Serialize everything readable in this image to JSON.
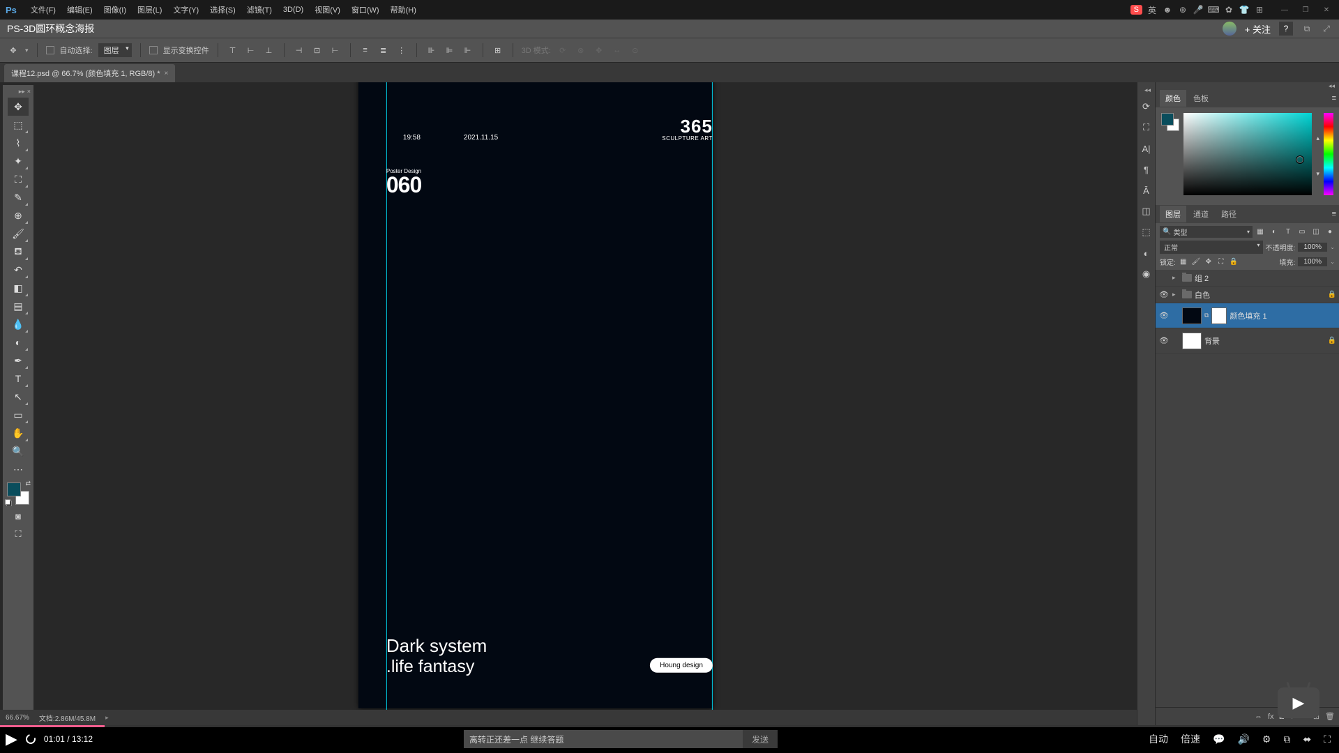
{
  "titlebar": {
    "logo": "Ps",
    "menus": [
      "文件(F)",
      "编辑(E)",
      "图像(I)",
      "图层(L)",
      "文字(Y)",
      "选择(S)",
      "滤镜(T)",
      "3D(D)",
      "视图(V)",
      "窗口(W)",
      "帮助(H)"
    ],
    "ime_badge": "S",
    "ime_text": "英"
  },
  "subtitle": {
    "title": "PS-3D圆环概念海报",
    "follow": "+ 关注",
    "help": "?"
  },
  "options": {
    "auto_select": "自动选择:",
    "target": "图层",
    "show_transform": "显示变换控件",
    "mode3d": "3D 模式:"
  },
  "doc_tab": {
    "label": "课程12.psd @ 66.7% (颜色填充 1, RGB/8) *",
    "close": "×"
  },
  "poster": {
    "time": "19:58",
    "date": "2021.11.15",
    "big_num": "365",
    "sculp": "SCULPTURE ART",
    "pd_label": "Poster Design",
    "num060": "060",
    "line1": "Dark system",
    "line2": ".life fantasy",
    "pill": "Houng design"
  },
  "panels": {
    "color_tab": "颜色",
    "swatch_tab": "色板",
    "layers_tab": "图层",
    "channels_tab": "通道",
    "paths_tab": "路径",
    "kind": "类型",
    "blend": "正常",
    "opacity_label": "不透明度:",
    "opacity_val": "100%",
    "lock_label": "锁定:",
    "fill_label": "填充:",
    "fill_val": "100%"
  },
  "layers": {
    "l1": "组 2",
    "l2": "白色",
    "l3": "颜色填充 1",
    "l4": "背景"
  },
  "status": {
    "zoom": "66.67%",
    "doc": "文档:2.86M/45.8M"
  },
  "video": {
    "cur": "01:01",
    "total": "13:12",
    "placeholder": "离转正还差一点 继续答题",
    "send": "发送",
    "auto": "自动",
    "speed": "倍速"
  }
}
